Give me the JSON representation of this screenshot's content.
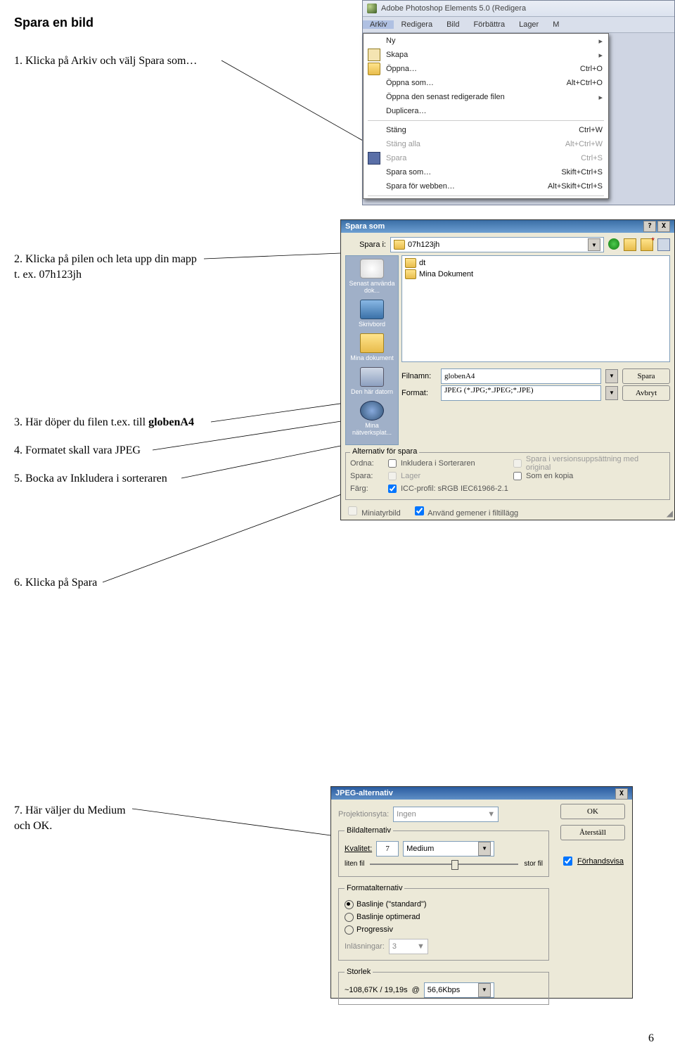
{
  "title": "Spara en bild",
  "steps": {
    "s1": "1. Klicka på Arkiv och välj Spara som…",
    "s2": "2. Klicka på pilen och leta upp din mapp t. ex. 07h123jh",
    "s3a": "3. Här döper du filen t.ex. till ",
    "s3b": "globenA4",
    "s4": "4. Formatet skall vara JPEG",
    "s5": "5. Bocka av Inkludera i sorteraren",
    "s6": "6. Klicka på Spara",
    "s7": "7. Här väljer du Medium och OK."
  },
  "ps": {
    "title": "Adobe Photoshop Elements 5.0 (Redigera",
    "menus": [
      "Arkiv",
      "Redigera",
      "Bild",
      "Förbättra",
      "Lager",
      "M"
    ],
    "items": [
      {
        "label": "Ny",
        "shortcut": "",
        "sub": true
      },
      {
        "label": "Skapa",
        "shortcut": "",
        "sub": true,
        "icon": "sheet"
      },
      {
        "label": "Öppna…",
        "shortcut": "Ctrl+O",
        "icon": "folder"
      },
      {
        "label": "Öppna som…",
        "shortcut": "Alt+Ctrl+O"
      },
      {
        "label": "Öppna den senast redigerade filen",
        "sub": true
      },
      {
        "label": "Duplicera…"
      }
    ],
    "items2": [
      {
        "label": "Stäng",
        "shortcut": "Ctrl+W"
      },
      {
        "label": "Stäng alla",
        "shortcut": "Alt+Ctrl+W",
        "disabled": true
      },
      {
        "label": "Spara",
        "shortcut": "Ctrl+S",
        "disabled": true,
        "icon": "floppy"
      },
      {
        "label": "Spara som…",
        "shortcut": "Skift+Ctrl+S"
      },
      {
        "label": "Spara för webben…",
        "shortcut": "Alt+Skift+Ctrl+S"
      }
    ]
  },
  "saveas": {
    "wintitle": "Spara som",
    "lookin_label": "Spara i:",
    "lookin_value": "07h123jh",
    "list": [
      {
        "name": "dt",
        "icon": "folder"
      },
      {
        "name": "Mina Dokument",
        "icon": "folder"
      }
    ],
    "places": [
      "Senast använda dok...",
      "Skrivbord",
      "Mina dokument",
      "Den här datorn",
      "Mina nätverksplat..."
    ],
    "filename_label": "Filnamn:",
    "filename": "globenA4",
    "format_label": "Format:",
    "format": "JPEG (*.JPG;*.JPEG;*.JPE)",
    "save_btn": "Spara",
    "cancel_btn": "Avbryt",
    "opts_legend": "Alternativ för spara",
    "ordna": "Ordna:",
    "inkludera": "Inkludera i Sorteraren",
    "spara_versions": "Spara i versionsuppsättning med original",
    "spara_label": "Spara:",
    "lager": "Lager",
    "kopia": "Som en kopia",
    "farg": "Färg:",
    "icc": "ICC-profil: sRGB IEC61966-2.1",
    "thumb": "Miniatyrbild",
    "gemener": "Använd gemener i filtillägg"
  },
  "jpeg": {
    "wintitle": "JPEG-alternativ",
    "matte_label": "Projektionsyta:",
    "matte_value": "Ingen",
    "ok": "OK",
    "reset": "Återställ",
    "preview": "Förhandsvisa",
    "imgopts": "Bildalternativ",
    "quality_label": "Kvalitet:",
    "quality_num": "7",
    "quality_name": "Medium",
    "small": "liten fil",
    "large": "stor fil",
    "fmt": "Formatalternativ",
    "fmt1": "Baslinje (\"standard\")",
    "fmt2": "Baslinje optimerad",
    "fmt3": "Progressiv",
    "scans_label": "Inläsningar:",
    "scans": "3",
    "size": "Storlek",
    "size_val": "~108,67K / 19,19s",
    "size_at": "@",
    "size_rate": "56,6Kbps"
  },
  "pagenum": "6"
}
